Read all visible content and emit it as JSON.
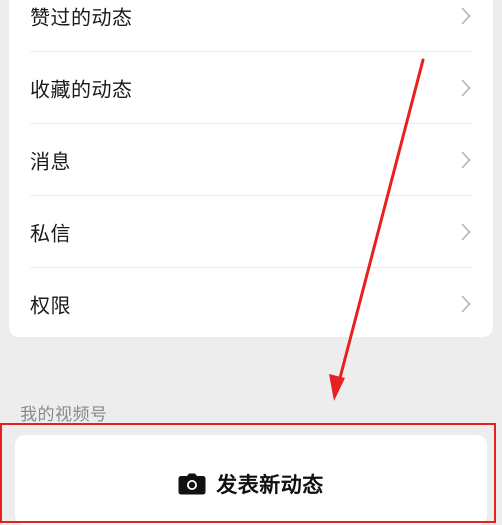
{
  "menu": {
    "items": [
      {
        "label": "赞过的动态",
        "icon": "chevron-right-icon"
      },
      {
        "label": "收藏的动态",
        "icon": "chevron-right-icon"
      },
      {
        "label": "消息",
        "icon": "chevron-right-icon"
      },
      {
        "label": "私信",
        "icon": "chevron-right-icon"
      },
      {
        "label": "权限",
        "icon": "chevron-right-icon"
      }
    ]
  },
  "channels": {
    "section_title": "我的视频号",
    "post_button_label": "发表新动态",
    "post_button_icon": "camera-icon"
  },
  "annotation": {
    "color": "#e8211f",
    "arrow_icon": "arrow-down-icon"
  }
}
